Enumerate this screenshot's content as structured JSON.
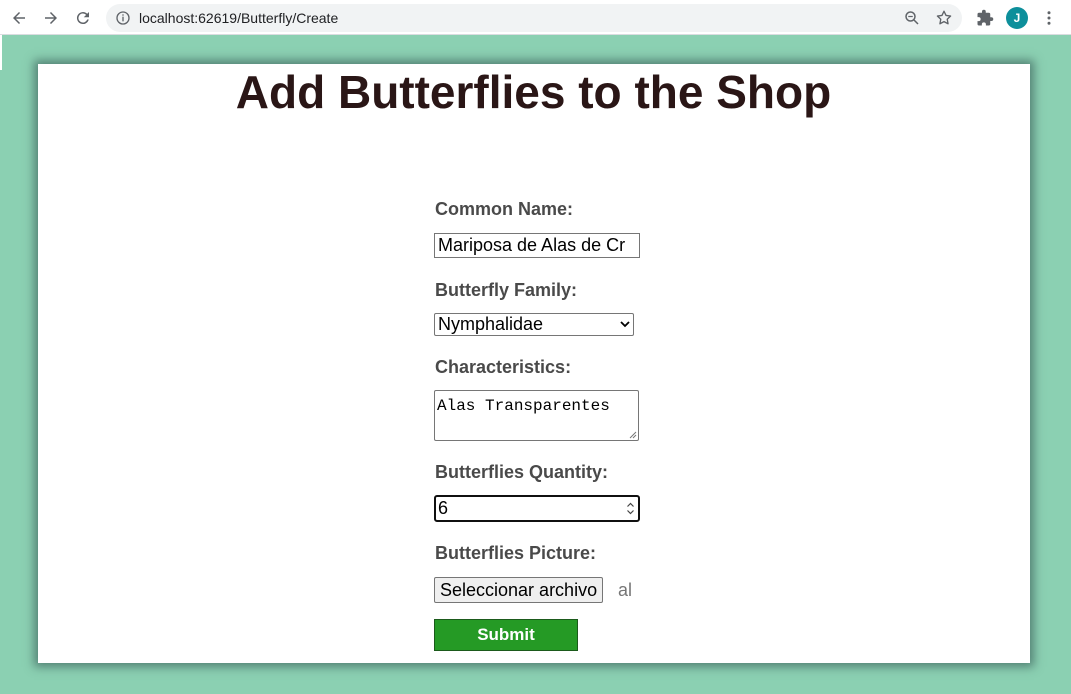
{
  "browser": {
    "url": "localhost:62619/Butterfly/Create",
    "avatar_letter": "J",
    "avatar_color": "#0d8f9b"
  },
  "page": {
    "title": "Add Butterflies to the Shop",
    "background_color": "#8bd0b2"
  },
  "form": {
    "common_name_label": "Common Name:",
    "common_name_value": "Mariposa de Alas de Cr",
    "family_label": "Butterfly Family:",
    "family_selected": "Nymphalidae",
    "characteristics_label": "Characteristics:",
    "characteristics_value": "Alas Transparentes",
    "quantity_label": "Butterflies Quantity:",
    "quantity_value": "6",
    "picture_label": "Butterflies Picture:",
    "file_button_label": "Seleccionar archivo",
    "file_name": "al",
    "submit_label": "Submit",
    "submit_color": "#259a25"
  }
}
